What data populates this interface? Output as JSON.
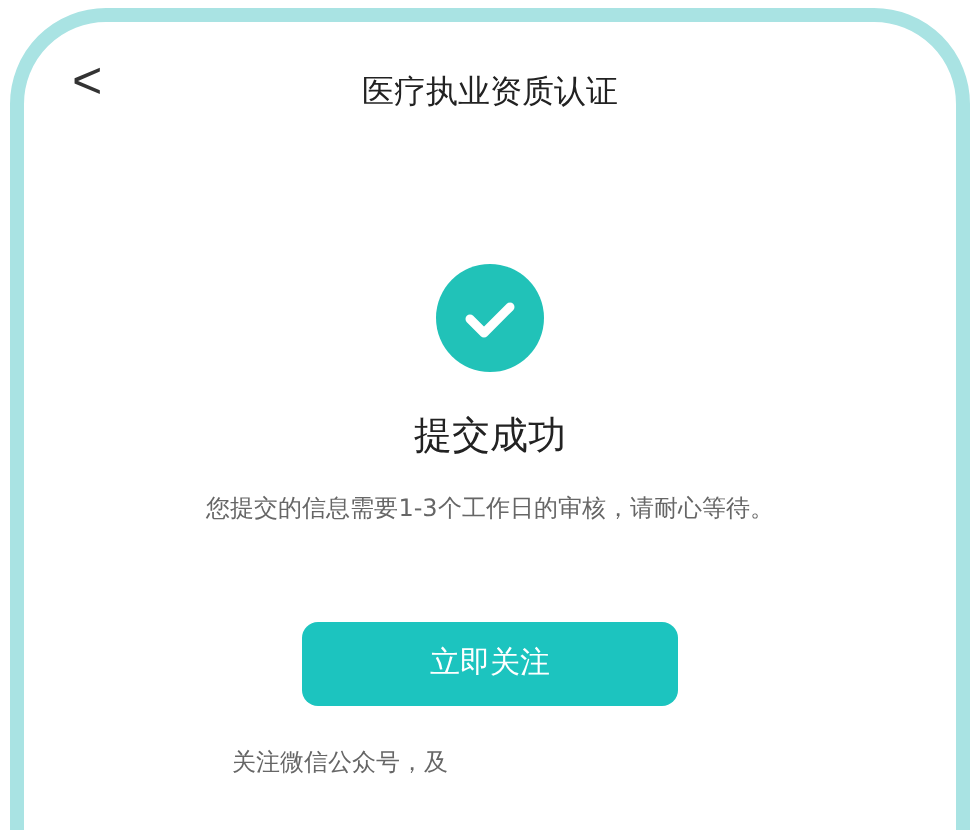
{
  "header": {
    "back_icon": "<",
    "title": "医疗执业资质认证"
  },
  "result": {
    "title": "提交成功",
    "message": "您提交的信息需要1-3个工作日的审核，请耐心等待。"
  },
  "follow_button": {
    "label": "立即关注"
  },
  "footer_note": "关注微信公众号，及"
}
